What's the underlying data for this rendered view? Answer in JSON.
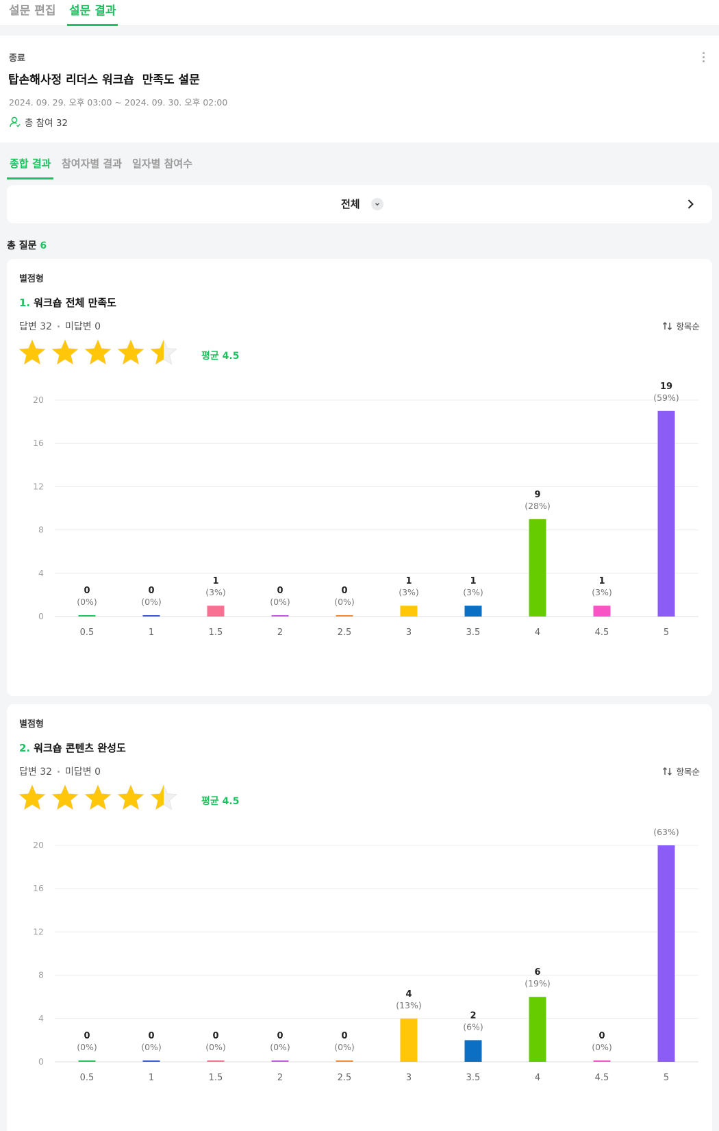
{
  "top_tabs": [
    "설문 편집",
    "설문 결과"
  ],
  "survey": {
    "status": "종료",
    "title": "탑손해사정 리더스 워크숍  만족도 설문",
    "period": "2024. 09. 29. 오후 03:00 ~ 2024. 09. 30. 오후 02:00",
    "participants": "총 참여 32"
  },
  "sub_tabs": [
    "종합 결과",
    "참여자별 결과",
    "일자별 참여수"
  ],
  "filter": {
    "label": "전체"
  },
  "total_questions": {
    "label": "총 질문",
    "count": "6"
  },
  "colors": {
    "accent": "#1ec15f",
    "star": "#ffc60a",
    "bars": [
      "#22c55e",
      "#3b5bdb",
      "#f87193",
      "#c05ce0",
      "#f08c3a",
      "#ffc60a",
      "#0b6fc4",
      "#66cc00",
      "#f954c4",
      "#8b5cf6"
    ]
  },
  "questions": [
    {
      "type": "별점형",
      "number": "1.",
      "title": "워크숍 전체 만족도",
      "answered": "답변 32",
      "unanswered": "미답변 0",
      "sort_label": "항목순",
      "average": "평균 4.5",
      "rating": 4.5,
      "chart_data": {
        "type": "bar",
        "categories": [
          "0.5",
          "1",
          "1.5",
          "2",
          "2.5",
          "3",
          "3.5",
          "4",
          "4.5",
          "5"
        ],
        "values": [
          0,
          0,
          1,
          0,
          0,
          1,
          1,
          9,
          1,
          19
        ],
        "percents": [
          "(0%)",
          "(0%)",
          "(3%)",
          "(0%)",
          "(0%)",
          "(3%)",
          "(3%)",
          "(28%)",
          "(3%)",
          "(59%)"
        ],
        "y_ticks": [
          0,
          4,
          8,
          12,
          16,
          20
        ],
        "ylim": [
          0,
          20
        ],
        "grid": true
      }
    },
    {
      "type": "별점형",
      "number": "2.",
      "title": "워크숍 콘텐츠 완성도",
      "answered": "답변 32",
      "unanswered": "미답변 0",
      "sort_label": "항목순",
      "average": "평균 4.5",
      "rating": 4.5,
      "chart_data": {
        "type": "bar",
        "categories": [
          "0.5",
          "1",
          "1.5",
          "2",
          "2.5",
          "3",
          "3.5",
          "4",
          "4.5",
          "5"
        ],
        "values": [
          0,
          0,
          0,
          0,
          0,
          4,
          2,
          6,
          0,
          20
        ],
        "percents": [
          "(0%)",
          "(0%)",
          "(0%)",
          "(0%)",
          "(0%)",
          "(13%)",
          "(6%)",
          "(19%)",
          "(0%)",
          "(63%)"
        ],
        "y_ticks": [
          0,
          4,
          8,
          12,
          16,
          20
        ],
        "ylim": [
          0,
          20
        ],
        "grid": true
      }
    }
  ]
}
